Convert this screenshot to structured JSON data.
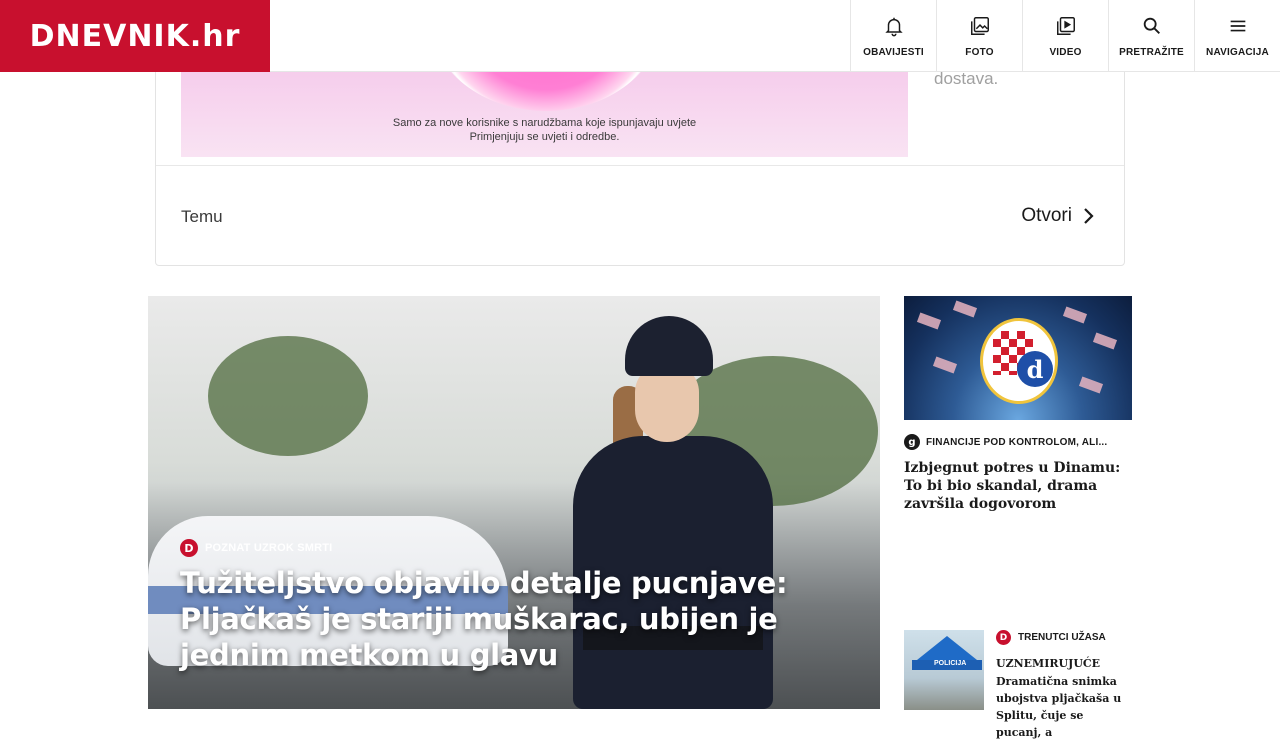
{
  "header": {
    "logo_text": "DNEVNIK.hr",
    "brand_color": "#c8102e",
    "nav": [
      {
        "label": "OBAVIJESTI",
        "icon": "bell-icon"
      },
      {
        "label": "FOTO",
        "icon": "photo-icon"
      },
      {
        "label": "VIDEO",
        "icon": "video-icon"
      },
      {
        "label": "PRETRAŽITE",
        "icon": "search-icon"
      },
      {
        "label": "NAVIGACIJA",
        "icon": "menu-icon"
      }
    ]
  },
  "ad": {
    "fine_print_1": "Samo za nove korisnike s narudžbama koje ispunjavaju uvjete",
    "fine_print_2": "Primjenjuju se uvjeti i odredbe.",
    "side_text": "dostava.",
    "brand": "Temu",
    "open_label": "Otvori"
  },
  "hero": {
    "kicker": "POZNAT UZROK SMRTI",
    "badge": "D",
    "title": "Tužiteljstvo objavilo detalje pucnjave: Pljačkaš je stariji muškarac, ubijen je jednim metkom u glavu"
  },
  "side_articles": [
    {
      "badge": "g",
      "kicker": "FINANCIJE POD KONTROLOM, ALI...",
      "title": "Izbjegnut potres u Dinamu: To bi bio skandal, drama završila dogovorom"
    },
    {
      "badge": "D",
      "kicker": "TRENUTCI UŽASA",
      "label": "UZNEMIRUJUĆE",
      "title": "Dramatična snimka ubojstva pljačkaša u Splitu, čuje se pucanj, a"
    }
  ]
}
